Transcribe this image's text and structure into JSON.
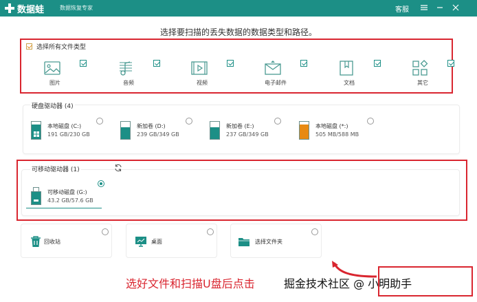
{
  "titlebar": {
    "app_name": "数据蛙",
    "app_subtitle": "数据恢复专家",
    "help_label": "客服",
    "menu_icon": "hamburger-icon",
    "minimize_icon": "minimize-icon",
    "close_icon": "close-icon"
  },
  "heading": "选择要扫描的丢失数据的数据类型和路径。",
  "file_types": {
    "select_all_label": "选择所有文件类型",
    "select_all_checked": true,
    "items": [
      {
        "label": "图片",
        "icon": "image-icon",
        "checked": true
      },
      {
        "label": "音频",
        "icon": "audio-icon",
        "checked": true
      },
      {
        "label": "视频",
        "icon": "video-icon",
        "checked": true
      },
      {
        "label": "电子邮件",
        "icon": "email-icon",
        "checked": true
      },
      {
        "label": "文档",
        "icon": "document-icon",
        "checked": true
      },
      {
        "label": "其它",
        "icon": "other-icon",
        "checked": true
      }
    ]
  },
  "hard_drives": {
    "title": "硬盘驱动器 (4)",
    "items": [
      {
        "name": "本地磁盘 (C:)",
        "size": "191 GB/230 GB",
        "used_fraction": 0.83,
        "color": "#1c8f86",
        "system": true
      },
      {
        "name": "新加卷 (D:)",
        "size": "239 GB/349 GB",
        "used_fraction": 0.68,
        "color": "#1c8f86",
        "system": false
      },
      {
        "name": "新加卷 (E:)",
        "size": "237 GB/349 GB",
        "used_fraction": 0.68,
        "color": "#1c8f86",
        "system": false
      },
      {
        "name": "本地磁盘 (*:)",
        "size": "505 MB/588 MB",
        "used_fraction": 0.86,
        "color": "#e88a12",
        "system": false
      }
    ]
  },
  "removable": {
    "title": "可移动驱动器 (1)",
    "refresh_icon": "refresh-icon",
    "items": [
      {
        "name": "可移动磁盘 (G:)",
        "size": "43.2 GB/57.6 GB",
        "selected": true
      }
    ]
  },
  "locations": [
    {
      "label": "回收站",
      "icon": "trash-icon"
    },
    {
      "label": "桌面",
      "icon": "desktop-icon"
    },
    {
      "label": "选择文件夹",
      "icon": "folder-icon"
    }
  ],
  "annotation": "选好文件和扫描U盘后点击",
  "watermark": "掘金技术社区 @ 小明助手",
  "colors": {
    "accent": "#1c8f86",
    "highlight": "#d9252f",
    "warning": "#e88a12"
  }
}
